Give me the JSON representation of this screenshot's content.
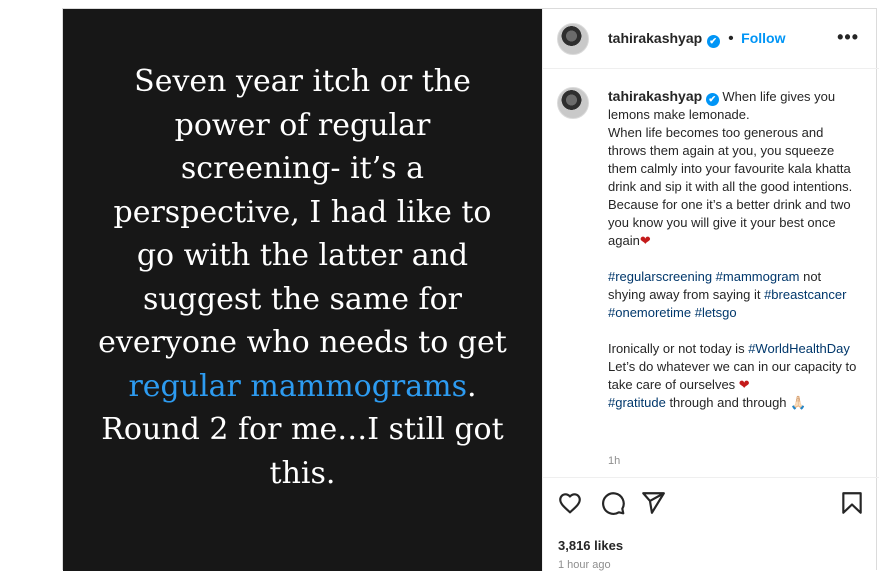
{
  "media": {
    "text_before": "Seven year itch or the power of regular screening- it’s a perspective, I had like to go with the latter and suggest the same for everyone who needs to get ",
    "highlight": "regular mammograms",
    "text_after": ". Round 2 for me…I still got this."
  },
  "header": {
    "username": "tahirakashyap",
    "verified_icon": "✔",
    "separator": "•",
    "follow_label": "Follow",
    "more_label": "•••"
  },
  "caption": {
    "username": "tahirakashyap",
    "p1_intro": " When life gives you lemons make lemonade.",
    "p1_body": "When life becomes too generous and throws them again at you, you squeeze them calmly into your favourite kala khatta drink and sip it with all the good intentions. Because for one it’s a better drink and two you know you will give it your best once again",
    "heart": "❤",
    "tags1": "#regularscreening #mammogram",
    "p2_text": " not shying away from saying it",
    "tags2": "#breastcancer #onemoretime #letsgo",
    "p3_text": "Ironically or not today is",
    "tag_whd": "#WorldHealthDay",
    "p3_rest": " Let’s do whatever we can in our capacity to take care of ourselves ",
    "tag_gratitude": "#gratitude",
    "p4_rest": " through and through ",
    "pray": "🙏🏻",
    "age": "1h"
  },
  "footer": {
    "likes": "3,816 likes",
    "posted": "1 hour ago"
  },
  "icons": {
    "like": "heart-outline-icon",
    "comment": "comment-bubble-icon",
    "share": "paper-plane-icon",
    "save": "bookmark-icon"
  },
  "colors": {
    "accent": "#0095f6",
    "highlight": "#2d9bf0",
    "hashtag": "#00376b",
    "media_bg": "#171717"
  }
}
